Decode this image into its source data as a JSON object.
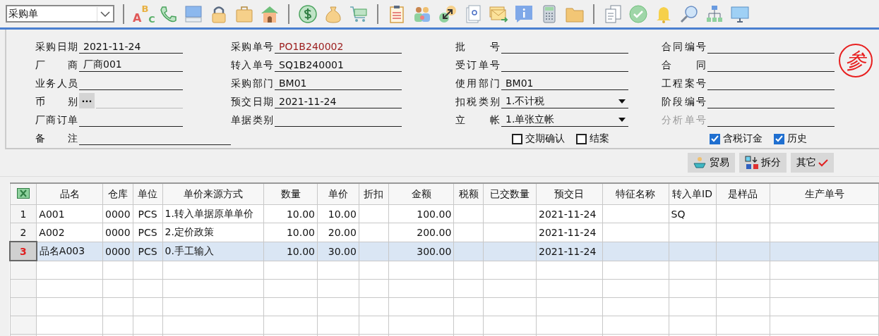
{
  "doc_type": {
    "value": "采购单"
  },
  "toolbar": [
    {
      "kind": "separator"
    },
    {
      "kind": "spelling",
      "letters": [
        "A",
        "B",
        "C"
      ]
    },
    {
      "kind": "phone"
    },
    {
      "kind": "computer"
    },
    {
      "kind": "lock"
    },
    {
      "kind": "briefcase"
    },
    {
      "kind": "house"
    },
    {
      "kind": "separator"
    },
    {
      "kind": "dollar"
    },
    {
      "kind": "moneybag"
    },
    {
      "kind": "cart"
    },
    {
      "kind": "separator"
    },
    {
      "kind": "clipboard"
    },
    {
      "kind": "people"
    },
    {
      "kind": "arrows"
    },
    {
      "kind": "help-doc"
    },
    {
      "kind": "mail"
    },
    {
      "kind": "info"
    },
    {
      "kind": "calculator"
    },
    {
      "kind": "folder"
    },
    {
      "kind": "separator"
    },
    {
      "kind": "copy-doc"
    },
    {
      "kind": "check"
    },
    {
      "kind": "bell"
    },
    {
      "kind": "search"
    },
    {
      "kind": "hierarchy"
    },
    {
      "kind": "monitor"
    }
  ],
  "form_columns": [
    [
      {
        "kind": "text",
        "label": "采购日期",
        "value": "2021-11-24"
      },
      {
        "kind": "text",
        "label": "厂 商",
        "value": "厂商001"
      },
      {
        "kind": "text",
        "label": "业务人员"
      },
      {
        "kind": "ellipsis",
        "label": "币 别",
        "button": "···"
      },
      {
        "kind": "text",
        "label": "厂商订单"
      },
      {
        "kind": "wide",
        "label": "备 注"
      }
    ],
    [
      {
        "kind": "text",
        "label": "采购单号",
        "value": "PO1B240002",
        "color": "#9b1c1c"
      },
      {
        "kind": "text",
        "label": "转入单号",
        "value": "SQ1B240001"
      },
      {
        "kind": "text",
        "label": "采购部门",
        "value": "BM01"
      },
      {
        "kind": "text",
        "label": "预交日期",
        "value": "2021-11-24"
      },
      {
        "kind": "text",
        "label": "单据类别"
      }
    ],
    [
      {
        "kind": "text",
        "label": "批 号"
      },
      {
        "kind": "text",
        "label": "受订单号"
      },
      {
        "kind": "text",
        "label": "使用部门",
        "value": "BM01"
      },
      {
        "kind": "select",
        "label": "扣税类别",
        "value": "1.不计税"
      },
      {
        "kind": "select",
        "label": "立 帐",
        "value": "1.单张立帐"
      },
      {
        "kind": "checks",
        "items": [
          {
            "label": "交期确认",
            "checked": false
          },
          {
            "label": "结案",
            "checked": false
          }
        ]
      }
    ],
    [
      {
        "kind": "text",
        "label": "合同编号"
      },
      {
        "kind": "text",
        "label": "合 同"
      },
      {
        "kind": "text",
        "label": "工程案号"
      },
      {
        "kind": "text",
        "label": "阶段编号"
      },
      {
        "kind": "text",
        "label": "分析单号",
        "disabled": true
      },
      {
        "kind": "checks",
        "items": [
          {
            "label": "含税订金",
            "checked": true
          },
          {
            "label": "历史",
            "checked": true
          }
        ]
      }
    ]
  ],
  "stamp": "参",
  "actions": [
    {
      "kind": "ship",
      "label": "贸易"
    },
    {
      "kind": "split",
      "label": "拆分"
    },
    {
      "kind": "tick",
      "label": "其它"
    }
  ],
  "table": {
    "columns": [
      "品名",
      "仓库",
      "单位",
      "单价来源方式",
      "数量",
      "单价",
      "折扣",
      "金额",
      "税额",
      "已交数量",
      "预交日",
      "特征名称",
      "转入单ID",
      "是样品",
      "生产单号"
    ],
    "rows": [
      {
        "number": "1",
        "selected": false,
        "cells": [
          "A001",
          "0000",
          "PCS",
          "1.转入单据原单单价",
          "10.00",
          "10.00",
          "",
          "100.00",
          "",
          "",
          "2021-11-24",
          "",
          "SQ",
          "",
          ""
        ]
      },
      {
        "number": "2",
        "selected": false,
        "cells": [
          "A002",
          "0000",
          "PCS",
          "2.定价政策",
          "10.00",
          "20.00",
          "",
          "200.00",
          "",
          "",
          "2021-11-24",
          "",
          "",
          "",
          ""
        ]
      },
      {
        "number": "3",
        "selected": true,
        "cells": [
          "品名A003",
          "0000",
          "PCS",
          "0.手工输入",
          "10.00",
          "30.00",
          "",
          "300.00",
          "",
          "",
          "2021-11-24",
          "",
          "",
          "",
          ""
        ]
      }
    ]
  }
}
